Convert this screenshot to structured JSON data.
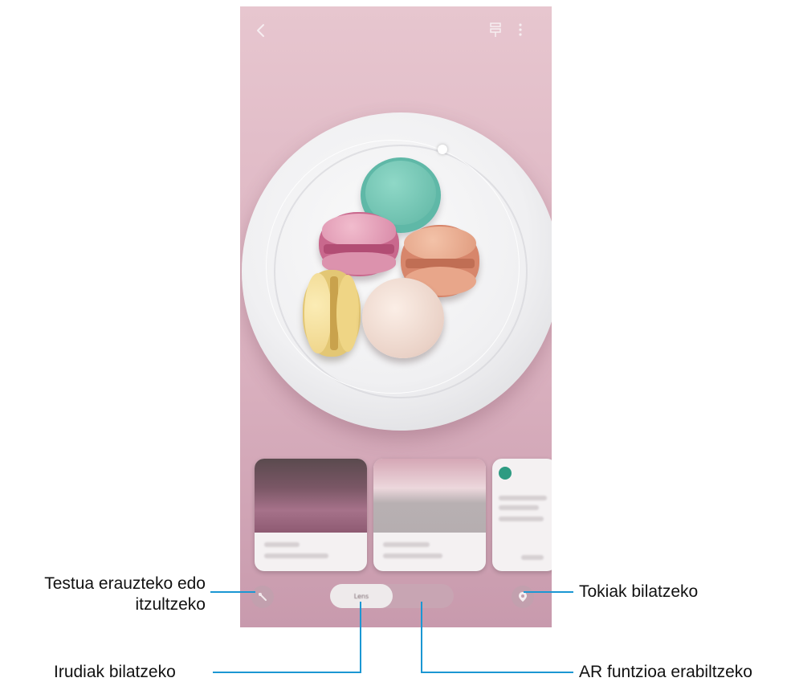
{
  "screen": {
    "top_icons": [
      "back-icon",
      "bixby-vision-icon",
      "more-options-icon"
    ],
    "bottom_modes": {
      "active": "Lens",
      "inactive": ""
    },
    "results": [
      {
        "title": "",
        "subtitle": ""
      },
      {
        "title": "",
        "subtitle": ""
      },
      {
        "title": "",
        "subtitle": ""
      }
    ]
  },
  "callouts": {
    "text_translate": "Testua erauzteko edo itzultzeko",
    "text_translate_line1": "Testua erauzteko edo",
    "text_translate_line2": "itzultzeko",
    "places": "Tokiak bilatzeko",
    "images": "Irudiak bilatzeko",
    "ar": "AR funtzioa erabiltzeko"
  },
  "colors": {
    "leader_line": "#1b97d3",
    "background_pink": "#dbb2c0"
  }
}
